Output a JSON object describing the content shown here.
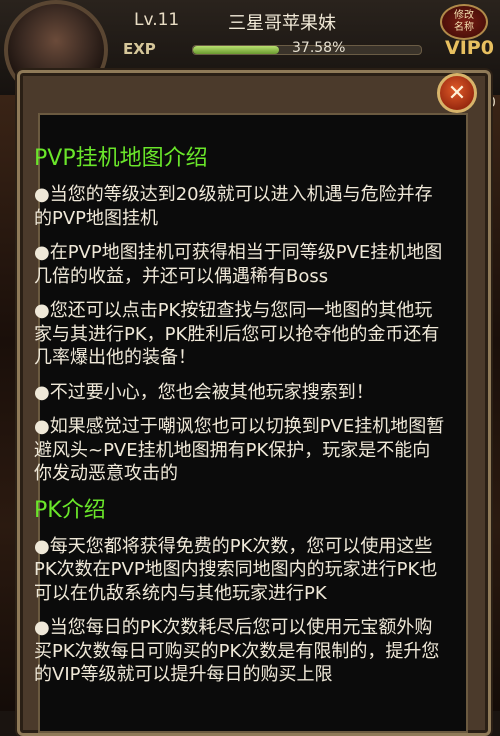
{
  "hud": {
    "level": "Lv.11",
    "player_name": "三星哥苹果妹",
    "exp_label": "EXP",
    "exp_percent_text": "37.58%",
    "exp_fraction": 0.3758,
    "vip_label": "VIP0",
    "rename_badge": "修改\n名称",
    "side_number": "0"
  },
  "dialog": {
    "close_glyph": "✕",
    "sections": [
      {
        "title": "PVP挂机地图介绍",
        "items": [
          "●当您的等级达到20级就可以进入机遇与危险并存的PVP地图挂机",
          "●在PVP地图挂机可获得相当于同等级PVE挂机地图几倍的收益，并还可以偶遇稀有Boss",
          "●您还可以点击PK按钮查找与您同一地图的其他玩家与其进行PK，PK胜利后您可以抢夺他的金币还有几率爆出他的装备！",
          "●不过要小心，您也会被其他玩家搜索到！",
          "●如果感觉过于嘲讽您也可以切换到PVE挂机地图暂避风头~PVE挂机地图拥有PK保护，玩家是不能向你发动恶意攻击的"
        ]
      },
      {
        "title": "PK介绍",
        "items": [
          "●每天您都将获得免费的PK次数，您可以使用这些PK次数在PVP地图内搜索同地图内的玩家进行PK也可以在仇敌系统内与其他玩家进行PK",
          "●当您每日的PK次数耗尽后您可以使用元宝额外购买PK次数每日可购买的PK次数是有限制的，提升您的VIP等级就可以提升每日的购买上限"
        ]
      }
    ]
  }
}
